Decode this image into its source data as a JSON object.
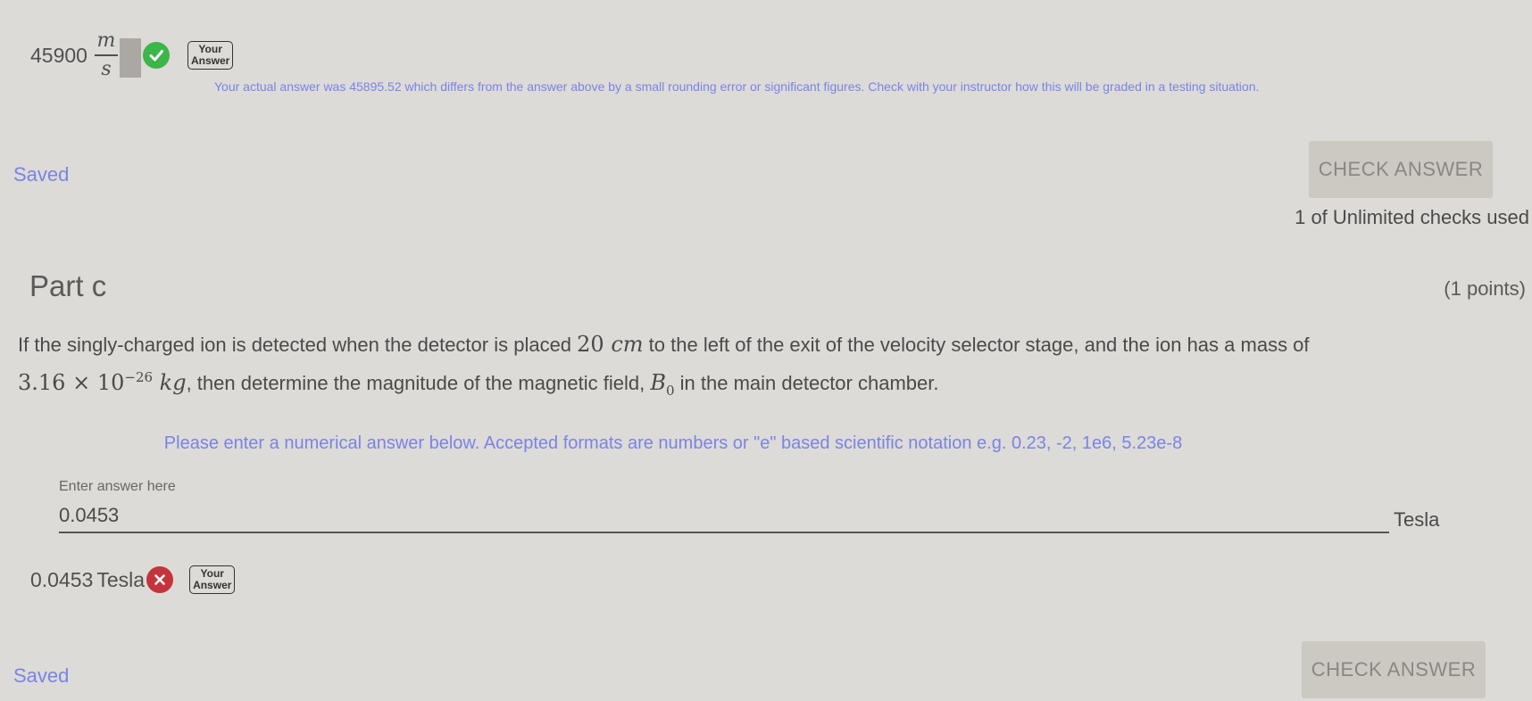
{
  "partb": {
    "answer_value": "45900",
    "unit_numerator": "m",
    "unit_denominator": "s",
    "your_answer_badge_line1": "Your",
    "your_answer_badge_line2": "Answer",
    "rounding_note": "Your actual answer was 45895.52 which differs from the answer above by a small rounding error or significant figures. Check with your instructor how this will be graded in a testing situation.",
    "saved_label": "Saved",
    "check_answer_label": "CHECK ANSWER",
    "checks_used": "1 of Unlimited checks used"
  },
  "partc": {
    "title": "Part c",
    "points": "(1 points)",
    "question_part1": "If the singly-charged ion is detected when the detector is placed ",
    "distance_value": "20",
    "distance_unit": "cm",
    "question_part2": " to the left of the exit of the velocity selector stage, and the ion has a mass of",
    "mass_mantissa": "3.16",
    "mass_times": "×",
    "mass_base": "10",
    "mass_exponent": "−26",
    "mass_unit": "kg",
    "question_part3": ", then determine the magnitude of the magnetic field, ",
    "field_symbol": "B",
    "field_subscript": "0",
    "question_part4": " in the main detector chamber.",
    "hint": "Please enter a numerical answer below. Accepted formats are numbers or \"e\" based scientific notation e.g. 0.23, -2, 1e6, 5.23e-8",
    "input_label": "Enter answer here",
    "input_value": "0.0453",
    "unit": "Tesla",
    "submitted_value": "0.0453",
    "submitted_unit": "Tesla",
    "your_answer_badge_line1": "Your",
    "your_answer_badge_line2": "Answer",
    "saved_label": "Saved",
    "check_answer_label": "CHECK ANSWER"
  },
  "icons": {
    "correct": "check-circle-icon",
    "incorrect": "x-circle-icon"
  },
  "colors": {
    "background": "#dcdbd7",
    "accent_blue": "#7b83e6",
    "correct_green": "#3cb549",
    "incorrect_red": "#c5343d"
  }
}
